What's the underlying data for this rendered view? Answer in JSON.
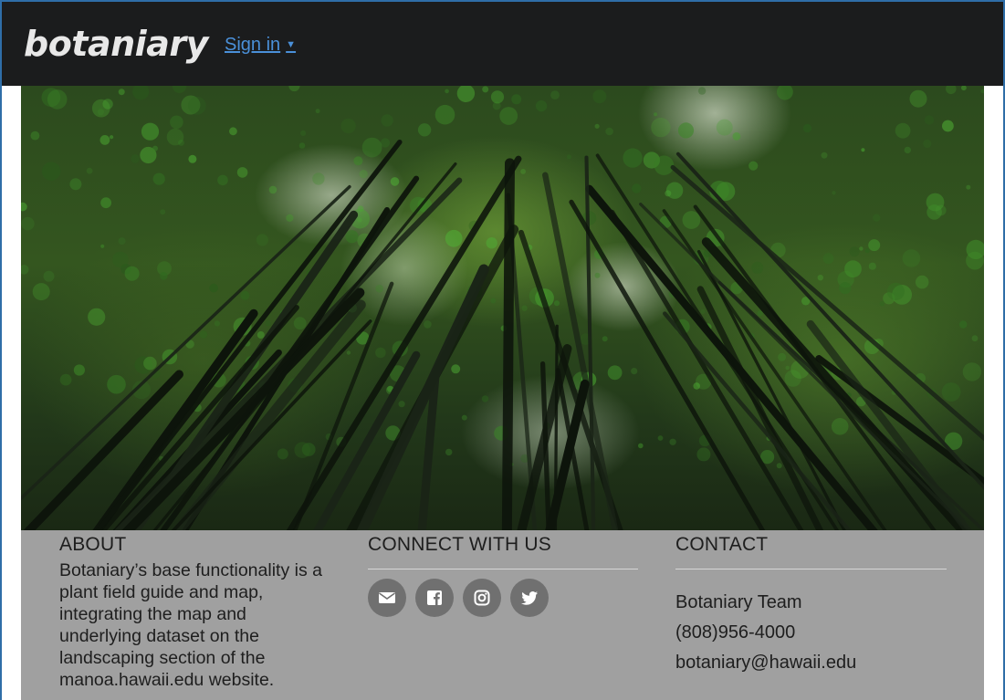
{
  "nav": {
    "brand": "botaniary",
    "signin_label": "Sign in",
    "caret": "▼"
  },
  "hero": {
    "icon": "bamboo-forest-photo"
  },
  "footer": {
    "about": {
      "heading": "ABOUT",
      "text": "Botaniary’s base functionality is a plant field guide and map, integrating the map and underlying dataset on the landscaping section of the manoa.hawaii.edu website."
    },
    "connect": {
      "heading": "CONNECT WITH US",
      "icons": [
        "envelope-icon",
        "facebook-icon",
        "instagram-icon",
        "twitter-icon"
      ]
    },
    "contact": {
      "heading": "CONTACT",
      "team": "Botaniary Team",
      "phone": "(808)956-4000",
      "email": "botaniary@hawaii.edu"
    }
  },
  "colors": {
    "navbar": "#1b1c1d",
    "link": "#4a90d9",
    "footer": "#a0a0a0",
    "icon_circle": "#707070"
  }
}
